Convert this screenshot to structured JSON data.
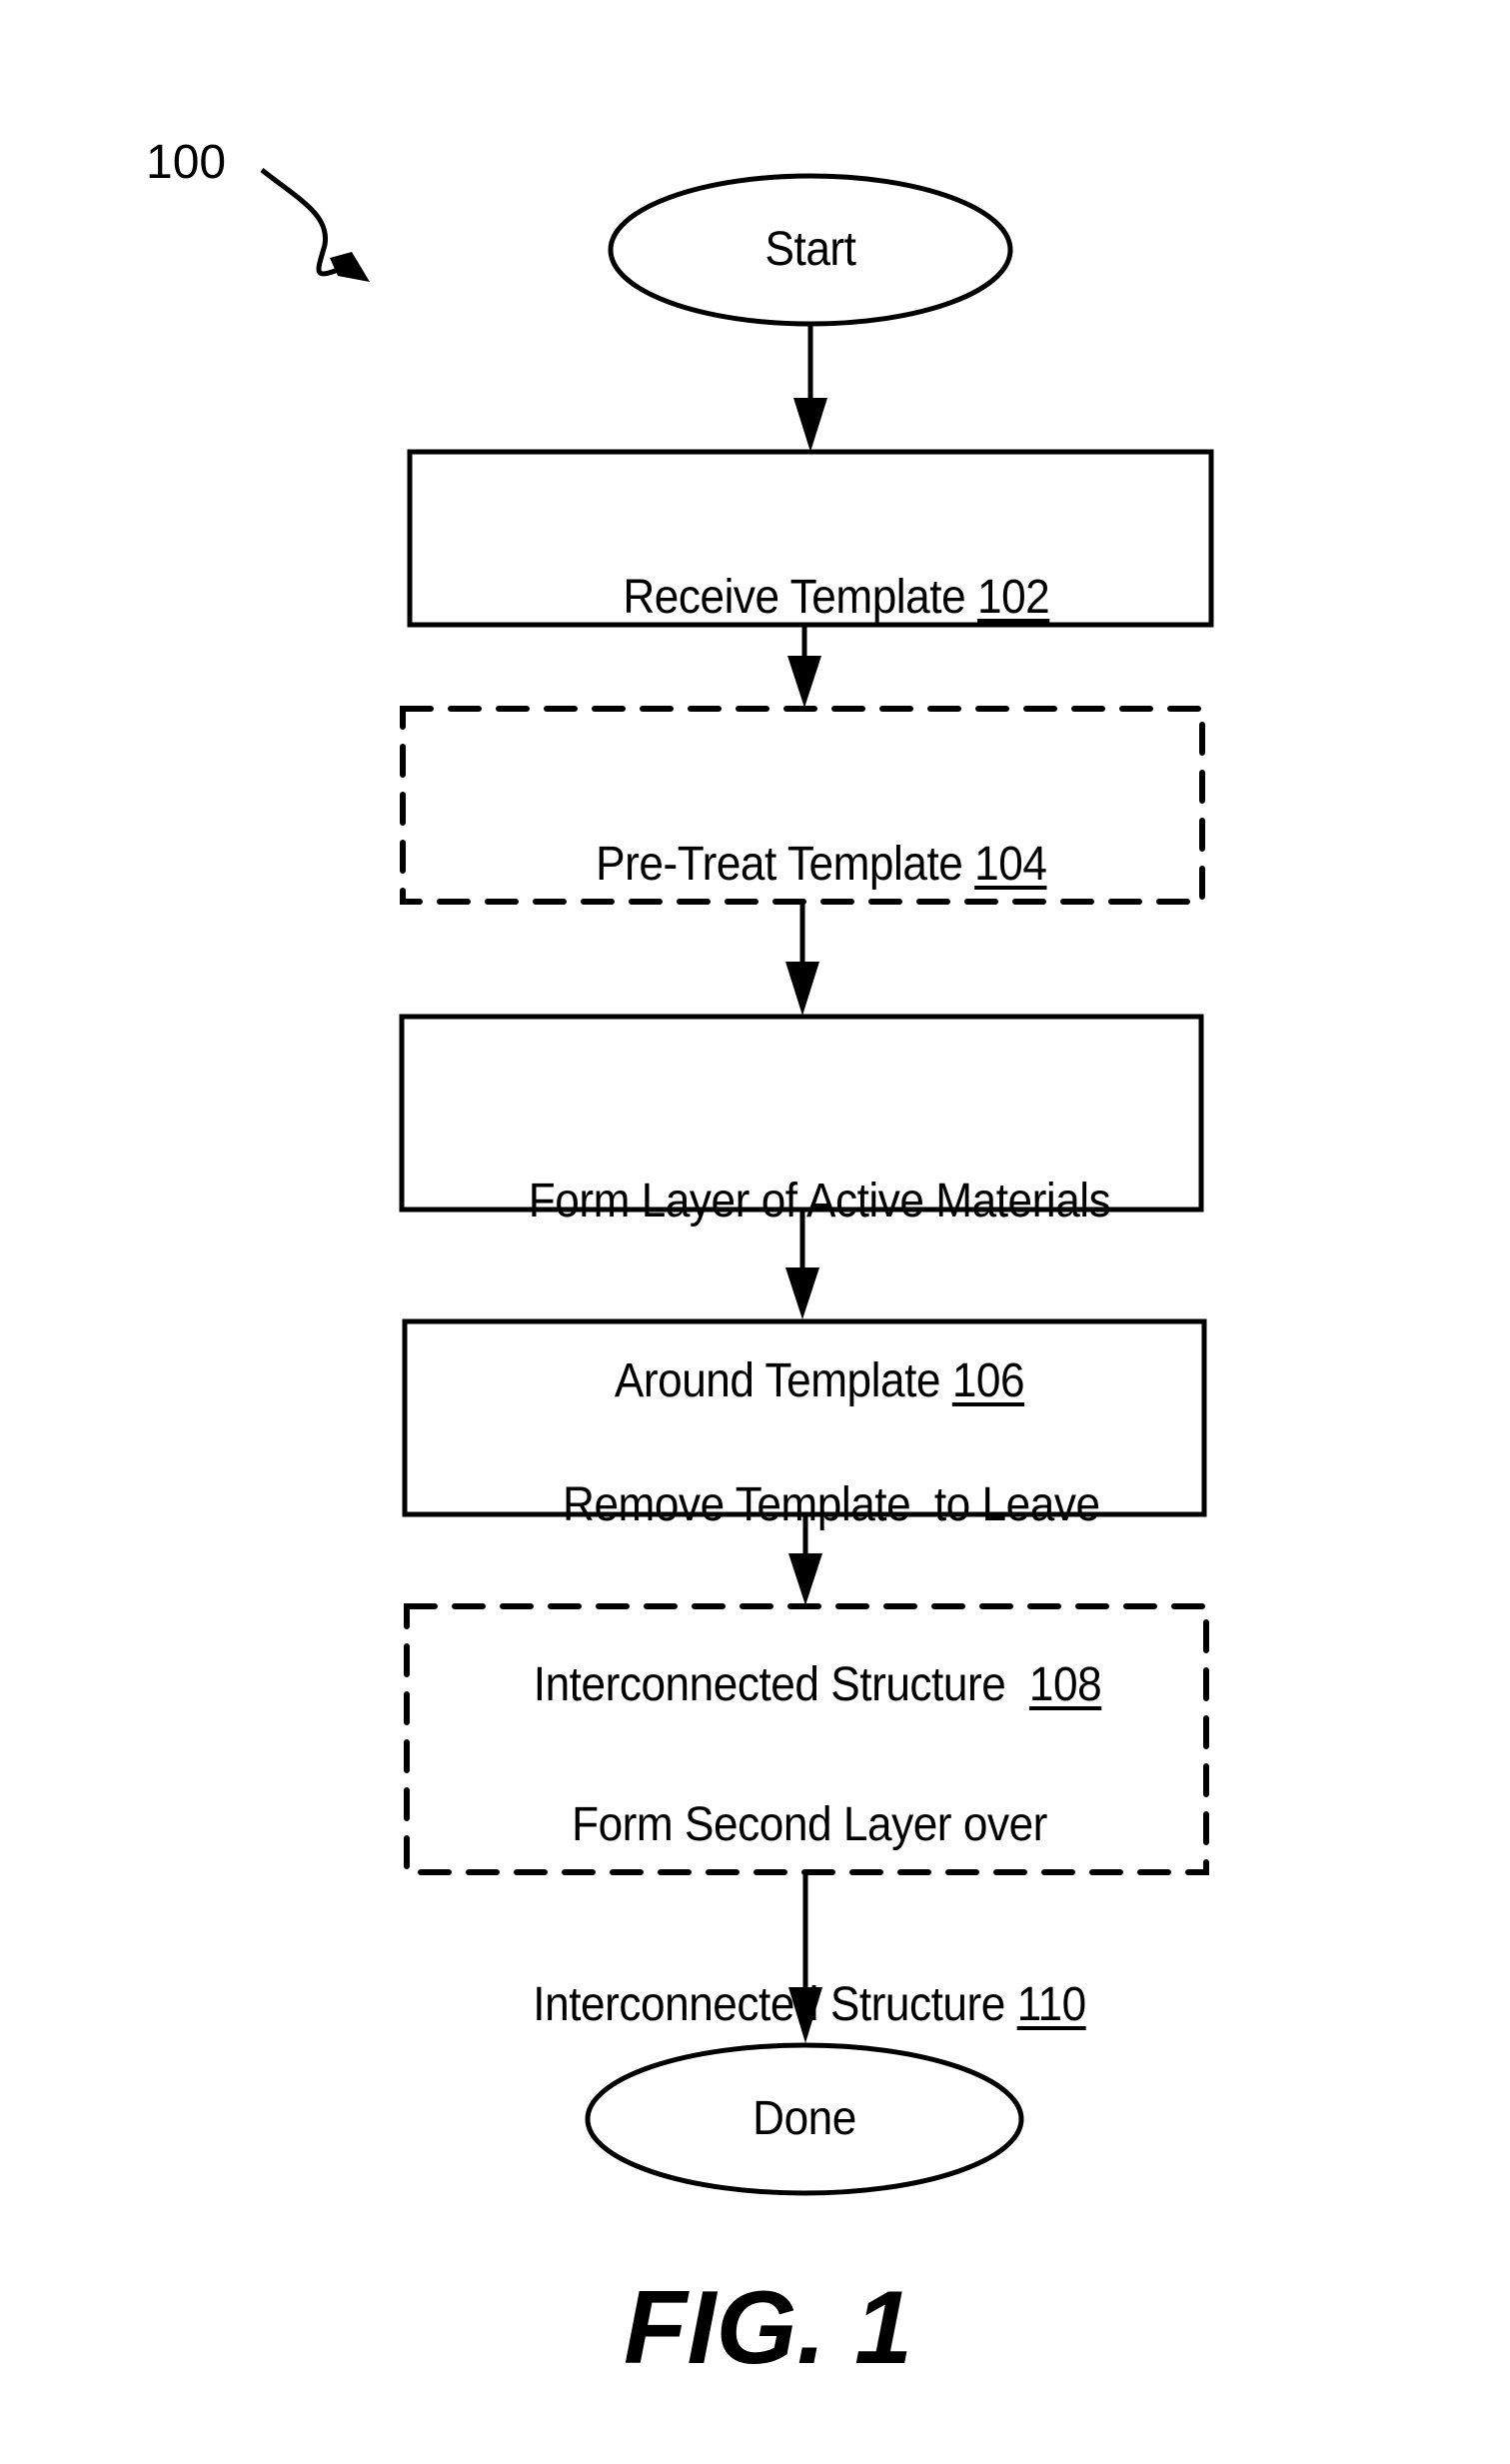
{
  "diagram": {
    "reference_number": "100",
    "figure_label": "FIG. 1",
    "nodes": [
      {
        "id": "start",
        "shape": "ellipse",
        "text": "Start",
        "ref": ""
      },
      {
        "id": "step102",
        "shape": "rect-solid",
        "lines": [
          "Receive Template "
        ],
        "ref": "102"
      },
      {
        "id": "step104",
        "shape": "rect-dashed",
        "lines": [
          "Pre-Treat Template "
        ],
        "ref": "104"
      },
      {
        "id": "step106",
        "shape": "rect-solid",
        "lines": [
          "Form Layer of Active Materials",
          "Around Template "
        ],
        "ref": "106"
      },
      {
        "id": "step108",
        "shape": "rect-solid",
        "lines": [
          "Remove Template  to Leave",
          "Interconnected Structure  "
        ],
        "ref": "108"
      },
      {
        "id": "step110",
        "shape": "rect-dashed",
        "lines": [
          "Form Second Layer over",
          "Interconnected Structure "
        ],
        "ref": "110"
      },
      {
        "id": "done",
        "shape": "ellipse",
        "text": "Done",
        "ref": ""
      }
    ]
  }
}
